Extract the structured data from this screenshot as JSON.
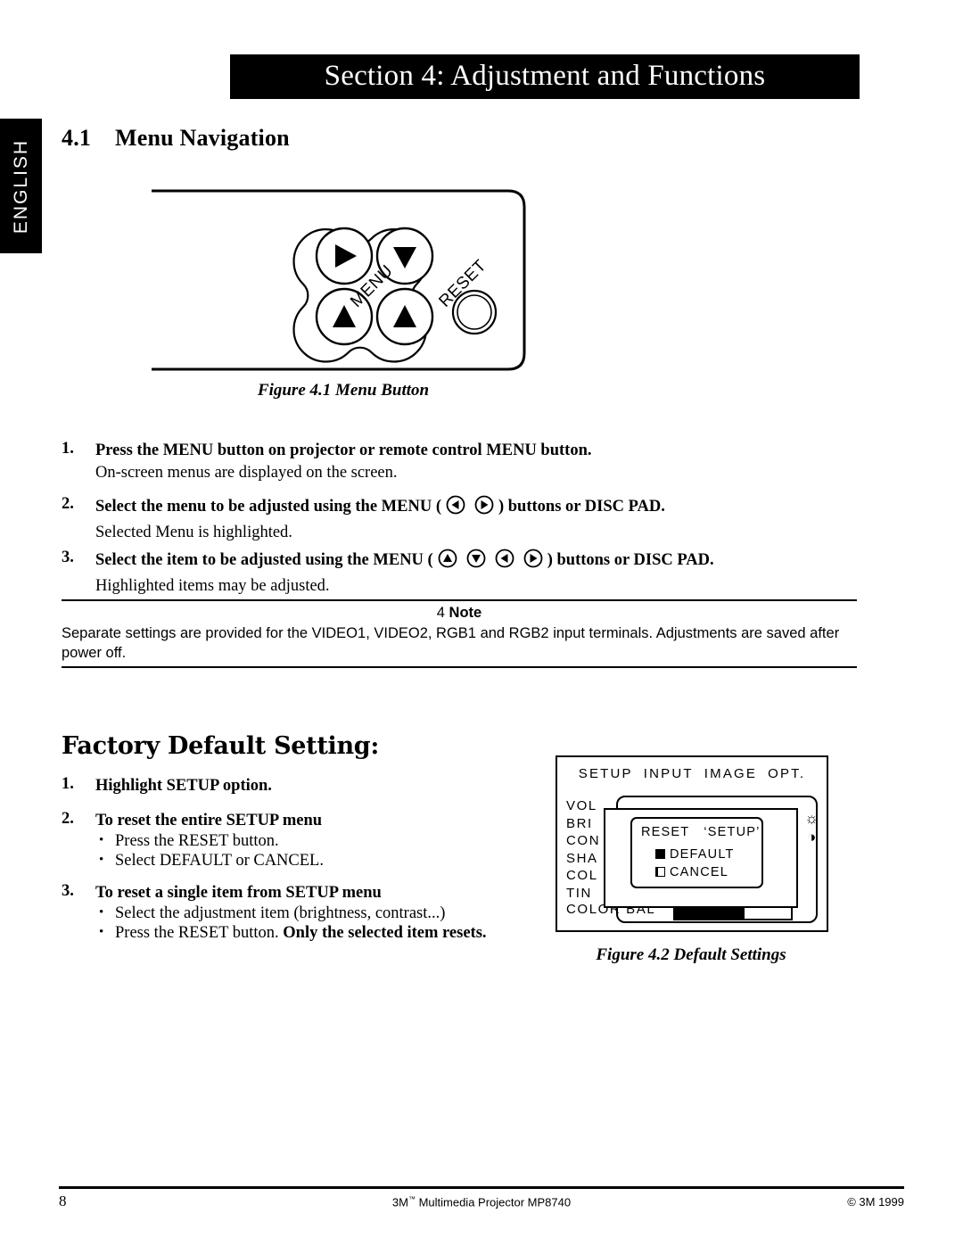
{
  "language_tab": {
    "label": "ENGLISH"
  },
  "section_banner": {
    "title": "Section 4: Adjustment and Functions"
  },
  "headings": {
    "menu_navigation_number": "4.1",
    "menu_navigation_title": "Menu Navigation",
    "factory_default_title": "Factory Default Setting:"
  },
  "figure1": {
    "caption": "Figure 4.1 Menu Button",
    "menu_label": "MENU",
    "reset_label": "RESET",
    "buttons": [
      {
        "name": "menu-right-button",
        "glyph": "▶"
      },
      {
        "name": "menu-down-button",
        "glyph": "▼"
      },
      {
        "name": "menu-left-button",
        "glyph": "▲"
      },
      {
        "name": "menu-up-button",
        "glyph": "▲"
      }
    ]
  },
  "steps": [
    {
      "number": "1.",
      "title_parts": [
        "Press the MENU button on projector or remote control MENU button."
      ],
      "icons": [],
      "sub": "On-screen menus are displayed on the screen."
    },
    {
      "number": "2.",
      "title_parts": [
        "Select the menu to be adjusted using the MENU (",
        ") buttons or DISC PAD."
      ],
      "icons": [
        "◀",
        "▶"
      ],
      "sub": "Selected Menu is highlighted."
    },
    {
      "number": "3.",
      "title_parts": [
        "Select the item to be adjusted using the MENU (",
        ") buttons or DISC PAD."
      ],
      "icons": [
        "▲",
        "▼",
        "◀",
        "▶"
      ],
      "sub": "Highlighted items may be adjusted."
    }
  ],
  "note": {
    "marker": "4",
    "heading": "Note",
    "body": "Separate settings are provided for the VIDEO1, VIDEO2, RGB1 and RGB2 input terminals.  Adjustments are saved after power off."
  },
  "factory_steps": [
    {
      "number": "1.",
      "title": "Highlight SETUP option.",
      "bullets": []
    },
    {
      "number": "2.",
      "title": "To reset the entire SETUP menu",
      "bullets": [
        {
          "text": "Press the RESET button.",
          "bold_tail": ""
        },
        {
          "text": "Select DEFAULT or CANCEL.",
          "bold_tail": ""
        }
      ]
    },
    {
      "number": "3.",
      "title": "To reset a single item from SETUP menu",
      "bullets": [
        {
          "text": "Select the adjustment item (brightness, contrast...)",
          "bold_tail": ""
        },
        {
          "text": "Press the RESET button.  ",
          "bold_tail": "Only the selected item resets."
        }
      ]
    }
  ],
  "figure2": {
    "caption": "Figure 4.2 Default Settings",
    "tabs": [
      "SETUP",
      "INPUT",
      "IMAGE",
      "OPT."
    ],
    "menu_items": [
      "VOL",
      "BRI",
      "CON",
      "SHA",
      "COL",
      "TIN"
    ],
    "color_bal_label": "COLOR BAL",
    "color_bal_percent": 60,
    "side_icons": [
      {
        "name": "brightness-icon",
        "glyph": "☼"
      },
      {
        "name": "contrast-icon",
        "glyph": "◑"
      }
    ],
    "dialog": {
      "title": "RESET",
      "target": "‘SETUP’",
      "options": [
        {
          "label": "DEFAULT",
          "selected": true
        },
        {
          "label": "CANCEL",
          "selected": false
        }
      ]
    }
  },
  "footer": {
    "page_number": "8",
    "product_brand": "3M",
    "product_tm": "™",
    "product_name": " Multimedia Projector MP8740",
    "copyright": "© 3M 1999"
  }
}
